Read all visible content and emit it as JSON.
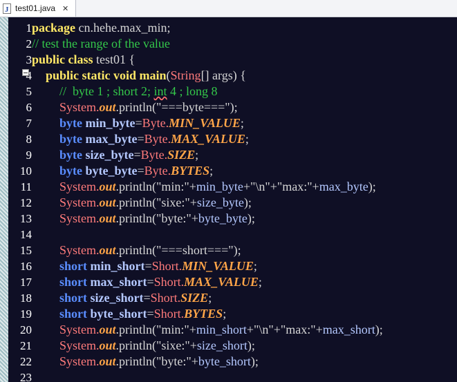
{
  "tab": {
    "title": "test01.java",
    "close_glyph": "✕",
    "icon": "java-file-icon"
  },
  "line_numbers": [
    "1",
    "2",
    "3",
    "4",
    "5",
    "6",
    "7",
    "8",
    "9",
    "10",
    "11",
    "12",
    "13",
    "14",
    "15",
    "16",
    "17",
    "18",
    "19",
    "20",
    "21",
    "22",
    "23"
  ],
  "code": {
    "l1": [
      "package",
      " cn.hehe.max_min;"
    ],
    "l2": [
      "// test the range of the value"
    ],
    "l3": [
      "public",
      " ",
      "class",
      " test01 {"
    ],
    "l4": [
      "public",
      " ",
      "static",
      " ",
      "void",
      " ",
      "main",
      "(",
      "String",
      "[] args) {"
    ],
    "l5": [
      "//  byte 1 ; short 2; ",
      "int",
      " 4 ; long 8"
    ],
    "l6": [
      "System.",
      "out",
      ".println(\"===byte===\");"
    ],
    "l7": [
      "byte",
      " ",
      "min_byte",
      "=",
      "Byte.",
      "MIN_VALUE",
      ";"
    ],
    "l8": [
      "byte",
      " ",
      "max_byte",
      "=",
      "Byte.",
      "MAX_VALUE",
      ";"
    ],
    "l9": [
      "byte",
      " ",
      "size_byte",
      "=",
      "Byte.",
      "SIZE",
      ";"
    ],
    "l10": [
      "byte",
      " ",
      "byte_byte",
      "=",
      "Byte.",
      "BYTES",
      ";"
    ],
    "l11": [
      "System.",
      "out",
      ".println(\"min:\"+",
      "min_byte",
      "+\"\\n\"+\"max:\"+",
      "max_byte",
      ");"
    ],
    "l12": [
      "System.",
      "out",
      ".println(\"sixe:\"+",
      "size_byte",
      ");"
    ],
    "l13": [
      "System.",
      "out",
      ".println(\"byte:\"+",
      "byte_byte",
      ");"
    ],
    "l14": [
      ""
    ],
    "l15": [
      "System.",
      "out",
      ".println(\"===short===\");"
    ],
    "l16": [
      "short",
      " ",
      "min_short",
      "=",
      "Short.",
      "MIN_VALUE",
      ";"
    ],
    "l17": [
      "short",
      " ",
      "max_short",
      "=",
      "Short.",
      "MAX_VALUE",
      ";"
    ],
    "l18": [
      "short",
      " ",
      "size_short",
      "=",
      "Short.",
      "SIZE",
      ";"
    ],
    "l19": [
      "short",
      " ",
      "byte_short",
      "=",
      "Short.",
      "BYTES",
      ";"
    ],
    "l20": [
      "System.",
      "out",
      ".println(\"min:\"+",
      "min_short",
      "+\"\\n\"+\"max:\"+",
      "max_short",
      ");"
    ],
    "l21": [
      "System.",
      "out",
      ".println(\"sixe:\"+",
      "size_short",
      ");"
    ],
    "l22": [
      "System.",
      "out",
      ".println(\"byte:\"+",
      "byte_short",
      ");"
    ],
    "l23": [
      ""
    ]
  },
  "colors": {
    "background": "#0f0f25",
    "keyword": "#5a8dff",
    "comment": "#34c84a",
    "field": "#ffa548",
    "class_ref": "#ff7b7b"
  }
}
